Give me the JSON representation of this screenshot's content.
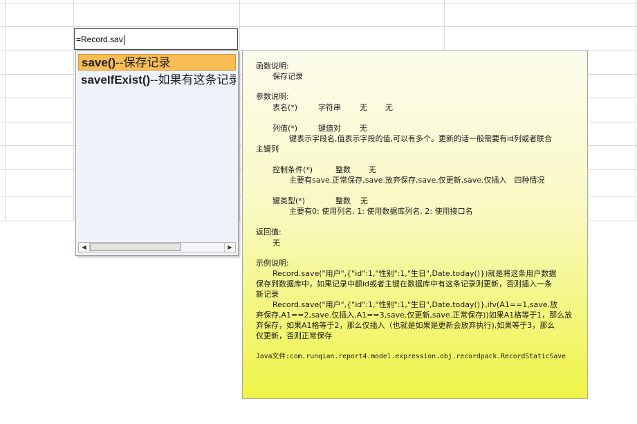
{
  "editor": {
    "formula": "=Record.sav"
  },
  "autocomplete": {
    "items": [
      {
        "fn": "save()",
        "desc": "--保存记录"
      },
      {
        "fn": "saveIfExist()",
        "desc": "--如果有这条记录"
      }
    ],
    "scroll_left_icon": "triangle-left",
    "scroll_right_icon": "triangle-right"
  },
  "tooltip": {
    "func_heading": "函数说明:",
    "func_desc": "保存记录",
    "params_heading": "参数说明:",
    "p1": {
      "name": "表名(*)",
      "type": "字符串",
      "v1": "无",
      "v2": "无"
    },
    "p2": {
      "name": "列值(*)",
      "type": "键值对",
      "v1": "无"
    },
    "p2_desc": "键表示字段名,值表示字段的值,可以有多个。更新的话一般需要有id列或者联合",
    "p2_desc2": "主键列",
    "p3": {
      "name": "控制条件(*)",
      "type": "整数",
      "v1": "无"
    },
    "p3_desc": "主要有save.正常保存,save.放弃保存,save.仅更新,save.仅插入　四种情况",
    "p4": {
      "name": "键类型(*)",
      "type": "整数",
      "v1": "无"
    },
    "p4_desc": "主要有0: 使用列名, 1: 使用数据库列名, 2: 使用接口名",
    "return_heading": "返回值:",
    "return_desc": "无",
    "example_heading": "示例说明:",
    "ex1_l1": "Record.save(\"用户\",{\"id\":1,\"性别\":1,\"生日\",Date.today()})就是将这条用户数据",
    "ex1_l2": "保存到数据库中，如果记录中额id或者主键在数据库中有这条记录则更新，否则插入一条",
    "ex1_l3": "新记录",
    "ex2_l1": "Record.save(\"用户\",{\"id\":1,\"性别\":1,\"生日\",Date.today()},ifv(A1==1,save.放",
    "ex2_l2": "弃保存,A1==2,save.仅插入,A1==3,save.仅更新,save.正常保存))如果A1格等于1，那么放",
    "ex2_l3": "弃保存，如果A1格等于2，那么仅插入（也就是如果是更新会放弃执行),如果等于3，那么",
    "ex2_l4": "仅更新，否则正常保存",
    "java_line": "Java文件:com.runqian.report4.model.expression.obj.recordpack.RecordStaticSave"
  }
}
